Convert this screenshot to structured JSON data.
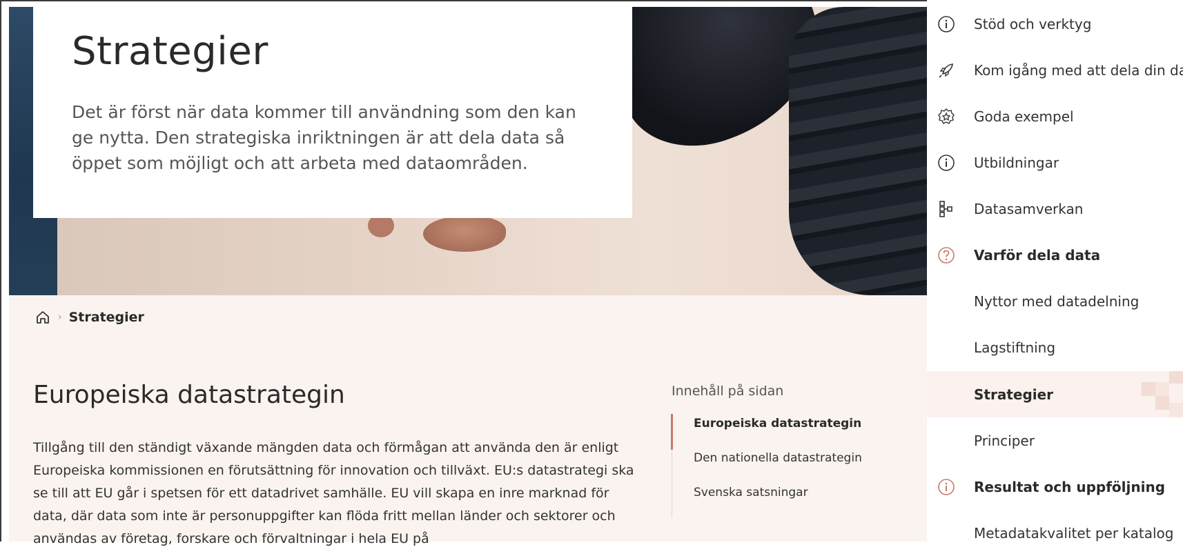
{
  "hero": {
    "title": "Strategier",
    "lead": "Det är först när data kommer till användning som den kan ge nytta. Den strategiska inriktningen är att dela data så öppet som möjligt och att arbeta med dataområden."
  },
  "breadcrumb": {
    "home_icon": "home-icon",
    "current": "Strategier"
  },
  "section": {
    "heading": "Europeiska datastrategin",
    "paragraph": "Tillgång till den ständigt växande mängden data och förmågan att använda den är enligt Europeiska kommissionen en förutsättning för innovation och tillväxt. EU:s datastrategi ska se till att EU går i spetsen för ett datadrivet samhälle. EU vill skapa en inre marknad för data, där data som inte är personuppgifter kan flöda fritt mellan länder och sektorer och användas av företag, forskare och förvaltningar i hela EU på"
  },
  "toc": {
    "title": "Innehåll på sidan",
    "items": [
      {
        "label": "Europeiska datastrategin",
        "active": true
      },
      {
        "label": "Den nationella datastrategin",
        "active": false
      },
      {
        "label": "Svenska satsningar",
        "active": false
      }
    ]
  },
  "sidebar": {
    "items": [
      {
        "label": "Stöd och verktyg",
        "icon": "info-icon"
      },
      {
        "label": "Kom igång med att dela din data",
        "icon": "rocket-icon"
      },
      {
        "label": "Goda exempel",
        "icon": "star-badge-icon"
      },
      {
        "label": "Utbildningar",
        "icon": "info-icon"
      },
      {
        "label": "Datasamverkan",
        "icon": "hierarchy-icon"
      },
      {
        "label": "Varför dela data",
        "icon": "question-icon"
      },
      {
        "label": "Nyttor med datadelning"
      },
      {
        "label": "Lagstiftning"
      },
      {
        "label": "Strategier"
      },
      {
        "label": "Principer"
      },
      {
        "label": "Resultat och uppföljning",
        "icon": "info-icon"
      },
      {
        "label": "Metadatakvalitet per katalog"
      }
    ],
    "accent_color": "#c87a6a"
  }
}
